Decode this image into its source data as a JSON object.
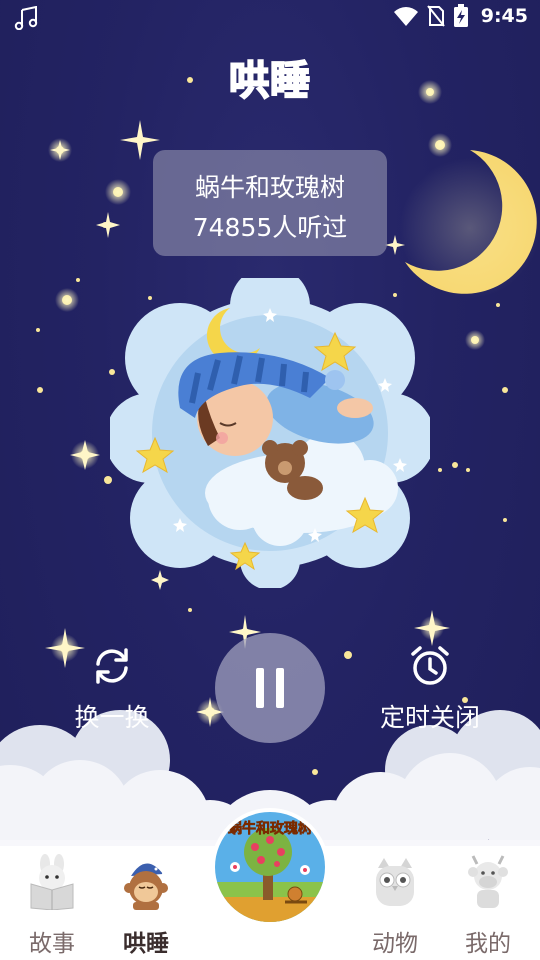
{
  "status_bar": {
    "time": "9:45",
    "icons": [
      "music-note-icon",
      "wifi-icon",
      "no-sim-icon",
      "battery-charging-icon"
    ]
  },
  "header": {
    "title": "哄睡"
  },
  "now_playing": {
    "title": "蜗牛和玫瑰树",
    "listen_count": "74855人听过",
    "cover_text": "蜗牛和玫瑰树"
  },
  "controls": {
    "shuffle_label": "换一换",
    "timer_label": "定时关闭",
    "state": "playing"
  },
  "tabs": [
    {
      "label": "故事",
      "icon": "book-bunny-icon",
      "active": false
    },
    {
      "label": "哄睡",
      "icon": "sleepy-monkey-icon",
      "active": true
    },
    {
      "label": "动物",
      "icon": "owl-icon",
      "active": false
    },
    {
      "label": "我的",
      "icon": "cow-avatar-icon",
      "active": false
    }
  ],
  "colors": {
    "background": "#232363",
    "moon": "#f7d873",
    "title": "#3d8bf0",
    "active_tab": "#3a2d2d",
    "inactive_tab": "#7a6a6a"
  }
}
